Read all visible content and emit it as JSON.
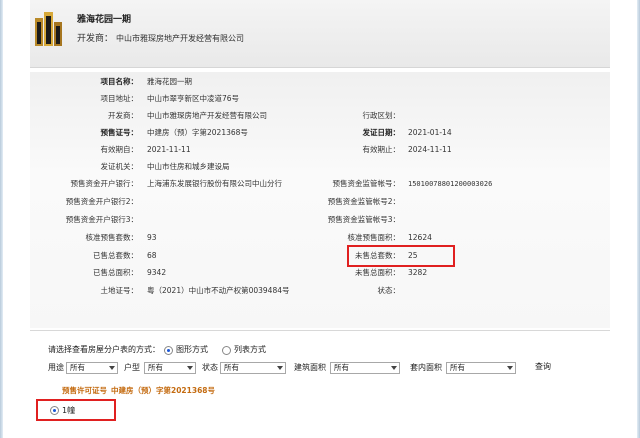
{
  "project": {
    "name": "雅海花园一期",
    "developer_label": "开发商：",
    "developer": "中山市雅琛房地产开发经营有限公司"
  },
  "info_rows": [
    {
      "k1": "项目名称：",
      "v1": "雅海花园一期",
      "k2": "",
      "v2": ""
    },
    {
      "k1": "项目地址：",
      "v1": "中山市翠亨新区中凌道76号",
      "k2": "",
      "v2": ""
    },
    {
      "k1": "开发商：",
      "v1": "中山市雅琛房地产开发经营有限公司",
      "k2": "行政区划：",
      "v2": ""
    },
    {
      "k1": "预售证号：",
      "v1": "中建房（预）字第2021368号",
      "k2": "发证日期：",
      "v2": "2021-01-14"
    },
    {
      "k1": "有效期自：",
      "v1": "2021-11-11",
      "k2": "有效期止：",
      "v2": "2024-11-11"
    },
    {
      "k1": "发证机关：",
      "v1": "中山市住房和城乡建设局",
      "k2": "",
      "v2": ""
    },
    {
      "k1": "预售资金开户银行：",
      "v1": "上海浦东发展银行股份有限公司中山分行",
      "k2": "预售资金监管帐号：",
      "v2": "15010078801200003026"
    },
    {
      "k1": "预售资金开户银行2：",
      "v1": "",
      "k2": "预售资金监管帐号2：",
      "v2": ""
    },
    {
      "k1": "预售资金开户银行3：",
      "v1": "",
      "k2": "预售资金监管帐号3：",
      "v2": ""
    },
    {
      "k1": "核准预售套数：",
      "v1": "93",
      "k2": "核准预售面积：",
      "v2": "12624"
    },
    {
      "k1": "已售总套数：",
      "v1": "68",
      "k2": "未售总套数：",
      "v2": "25"
    },
    {
      "k1": "已售总面积：",
      "v1": "9342",
      "k2": "未售总面积：",
      "v2": "3282"
    },
    {
      "k1": "土地证号：",
      "v1": "粤（2021）中山市不动产权第0039484号",
      "k2": "状态：",
      "v2": ""
    }
  ],
  "view_mode": {
    "prompt": "请选择查看房屋分户表的方式：",
    "option_graphic": "图形方式",
    "option_list": "列表方式",
    "selected": "graphic"
  },
  "filters": {
    "usage_label": "用途",
    "usage_value": "所有",
    "type_label": "户型",
    "type_value": "所有",
    "status_label": "状态",
    "status_value": "所有",
    "build_area_label": "建筑面积",
    "build_area_value": "所有",
    "inner_area_label": "套内面积",
    "inner_area_value": "所有",
    "query_label": "查询"
  },
  "permit": {
    "label": "预售许可证号",
    "number": "中建房（预）字第2021368号"
  },
  "building": {
    "label": "1幢"
  },
  "colors": {
    "highlight": "#e02020",
    "permit_text": "#c46b10",
    "radio_dot": "#1a56d6"
  }
}
